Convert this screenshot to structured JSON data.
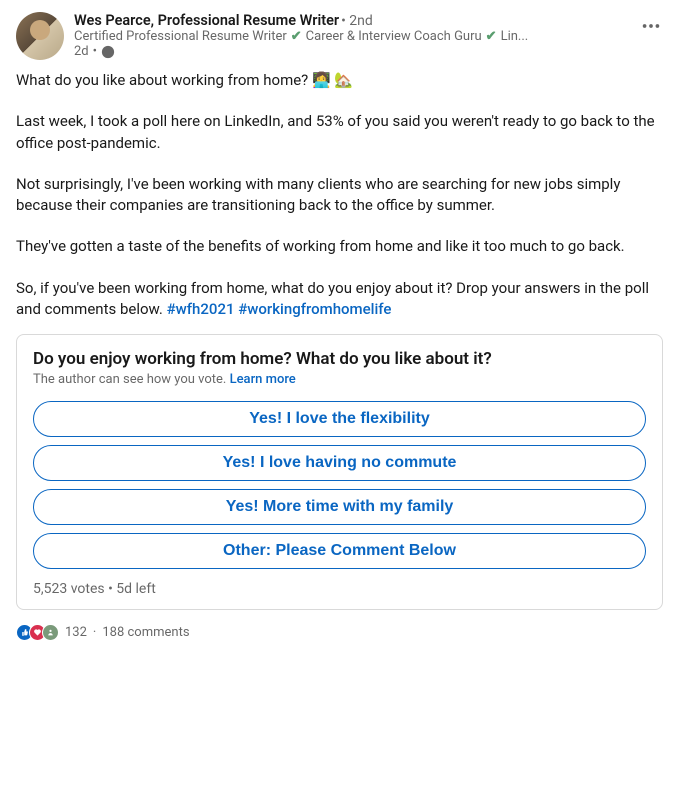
{
  "author": {
    "name": "Wes Pearce, Professional Resume Writer",
    "degree": "• 2nd",
    "headline_p1": "Certified Professional Resume Writer",
    "headline_p2": "Career & Interview Coach Guru",
    "headline_p3": "Lin...",
    "time": "2d",
    "dot": "•"
  },
  "body": {
    "p1_a": "What do you like about working from home? ",
    "p1_emoji": "👩‍💻 🏡",
    "p2": "Last week, I took a poll here on LinkedIn, and 53% of you said you weren't ready to go back to the office post-pandemic.",
    "p3": "Not surprisingly, I've been working with many clients who are searching for new jobs simply because their companies are transitioning back to the office by summer.",
    "p4": "They've gotten a taste of the benefits of working from home and like it too much to go back.",
    "p5_a": "So, if you've been working from home, what do you enjoy about it? Drop your answers in the poll and comments below. ",
    "p5_h1": "#wfh2021",
    "p5_sp": " ",
    "p5_h2": "#workingfromhomelife"
  },
  "poll": {
    "question": "Do you enjoy working from home? What do you like about it?",
    "subtext": "The author can see how you vote. ",
    "learn_more": "Learn more",
    "options": [
      "Yes! I love the flexibility",
      "Yes! I love having no commute",
      "Yes! More time with my family",
      "Other: Please Comment Below"
    ],
    "votes": "5,523 votes",
    "sep": " • ",
    "time_left": "5d left"
  },
  "social": {
    "reactions_count": "132",
    "sep": " · ",
    "comments": "188 comments"
  }
}
